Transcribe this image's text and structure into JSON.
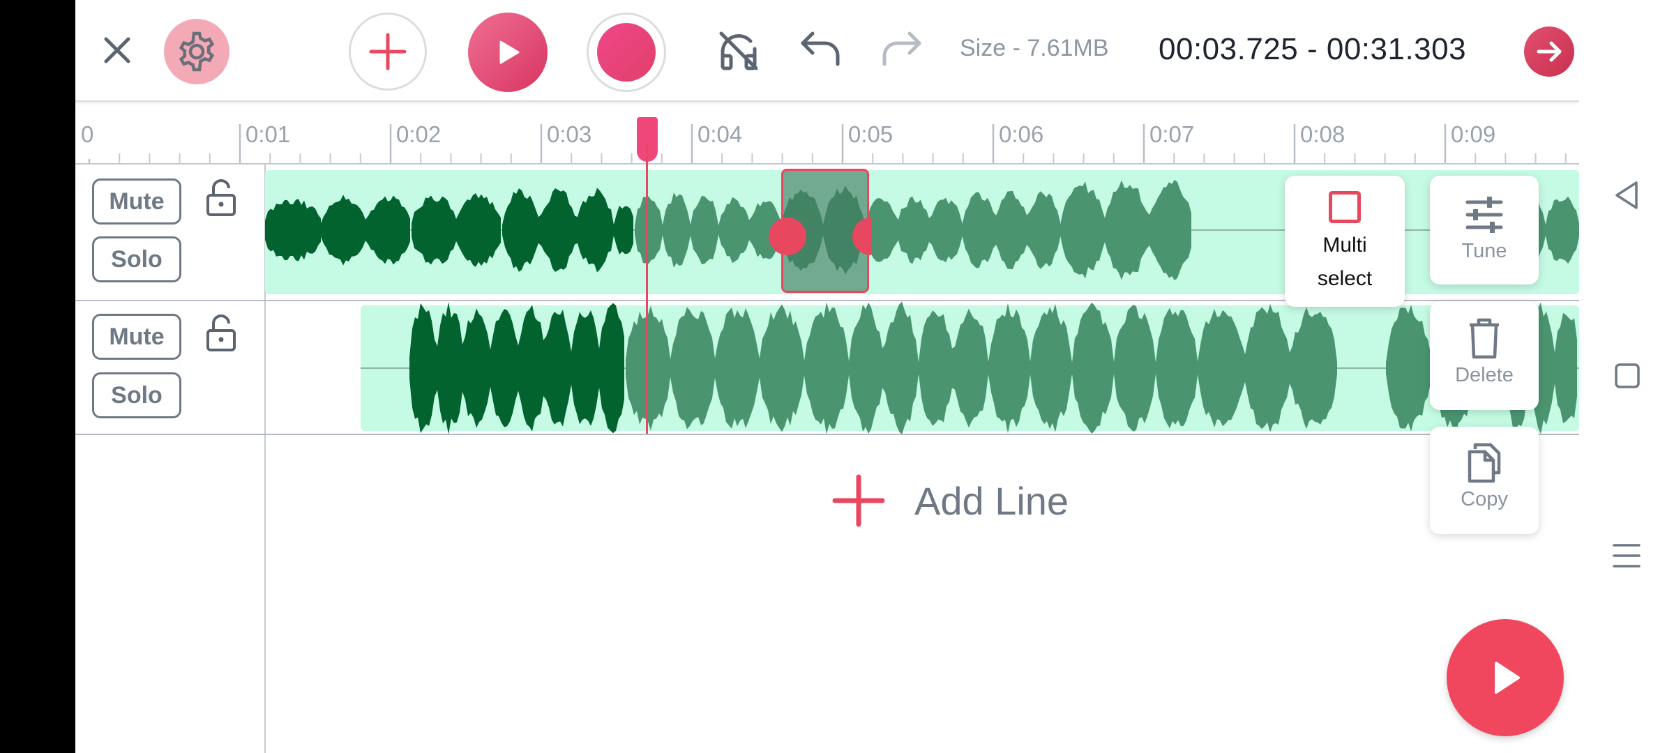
{
  "topbar": {
    "size_text": "Size - 7.61MB",
    "time_range": "00:03.725 - 00:31.303",
    "icons": [
      "close-icon",
      "gear-icon",
      "add-icon",
      "play-icon",
      "record-icon",
      "headphones-off-icon",
      "undo-icon",
      "redo-icon",
      "arrow-right-icon"
    ]
  },
  "ruler": {
    "ticks": [
      "0",
      "0:01",
      "0:02",
      "0:03",
      "0:04",
      "0:05",
      "0:06",
      "0:07",
      "0:08",
      "0:09"
    ]
  },
  "tracks": [
    {
      "mute_label": "Mute",
      "solo_label": "Solo"
    },
    {
      "mute_label": "Mute",
      "solo_label": "Solo"
    }
  ],
  "context_menu": {
    "multi_select_label": "Multi select",
    "tune_label": "Tune",
    "delete_label": "Delete",
    "copy_label": "Copy"
  },
  "add_line_label": "Add Line",
  "colors": {
    "accent": "#e8485f",
    "wave_dark": "#02632f",
    "wave_light": "#4a9570",
    "clip_bg": "#c5fbe4"
  }
}
